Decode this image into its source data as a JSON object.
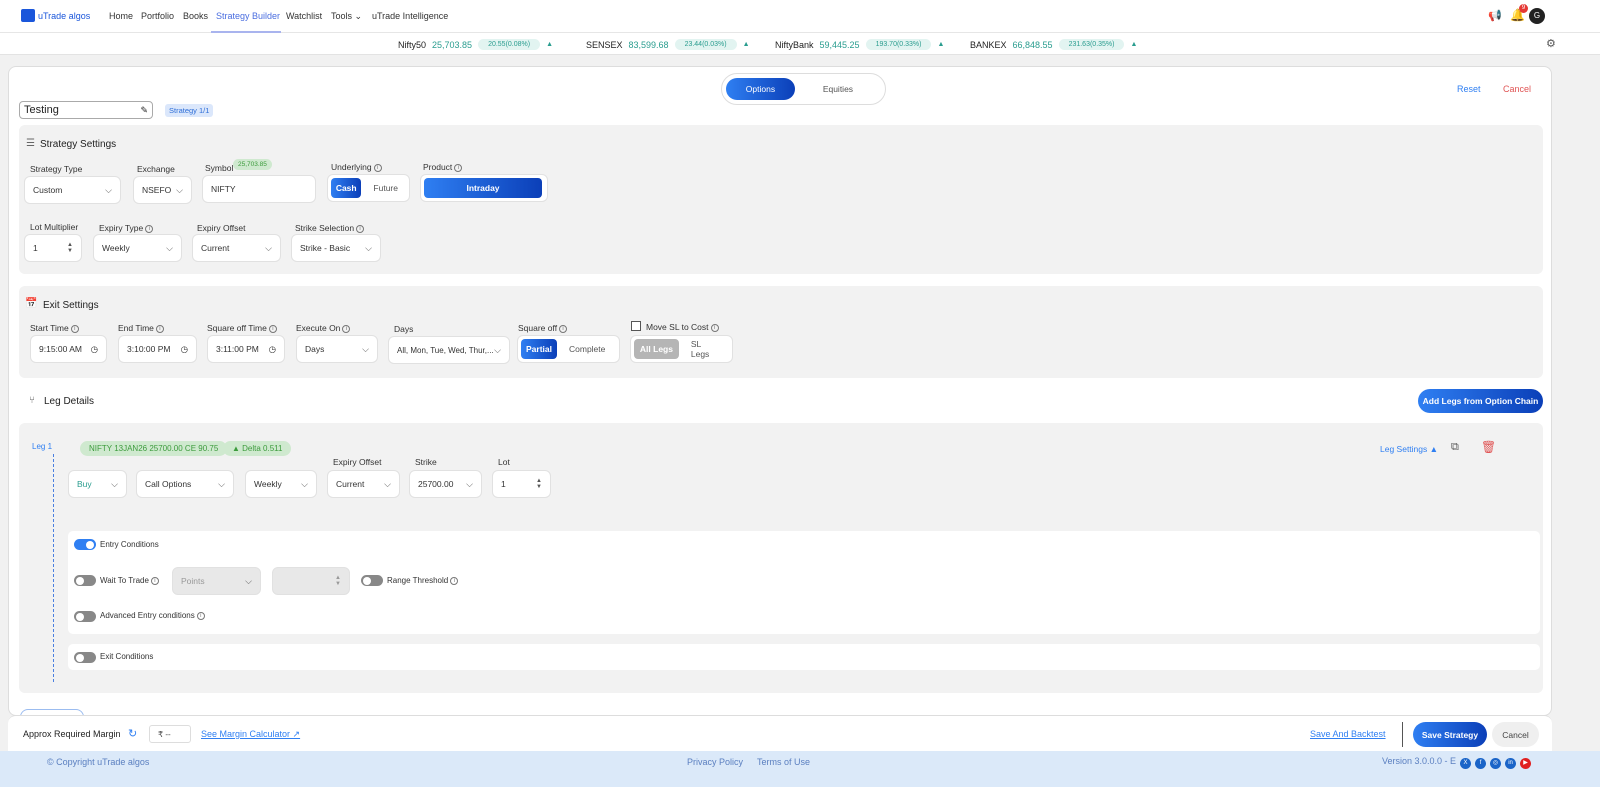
{
  "brand": {
    "name": "uTrade algos"
  },
  "nav": {
    "items": [
      "Home",
      "Portfolio",
      "Books",
      "Strategy Builder",
      "Watchlist",
      "Tools",
      "uTrade Intelligence"
    ],
    "active": "Strategy Builder",
    "notification_count": "9",
    "avatar": "G"
  },
  "ticker": [
    {
      "name": "Nifty50",
      "value": "25,703.85",
      "change": "20.55(0.08%)"
    },
    {
      "name": "SENSEX",
      "value": "83,599.68",
      "change": "23.44(0.03%)"
    },
    {
      "name": "NiftyBank",
      "value": "59,445.25",
      "change": "193.70(0.33%)"
    },
    {
      "name": "BANKEX",
      "value": "66,848.55",
      "change": "231.63(0.35%)"
    }
  ],
  "mode_tabs": {
    "options": "Options",
    "equities": "Equities",
    "active": "Options"
  },
  "header": {
    "strategy_name": "Testing",
    "strategy_badge": "Strategy 1/1",
    "reset": "Reset",
    "cancel": "Cancel"
  },
  "strategy_settings": {
    "title": "Strategy Settings",
    "strategy_type": {
      "label": "Strategy Type",
      "value": "Custom"
    },
    "exchange": {
      "label": "Exchange",
      "value": "NSEFO"
    },
    "symbol": {
      "label": "Symbol",
      "price": "25,703.85",
      "value": "NIFTY"
    },
    "underlying": {
      "label": "Underlying",
      "options": [
        "Cash",
        "Future"
      ],
      "selected": "Cash"
    },
    "product": {
      "label": "Product",
      "value": "Intraday"
    },
    "lot_multiplier": {
      "label": "Lot Multiplier",
      "value": "1"
    },
    "expiry_type": {
      "label": "Expiry Type",
      "value": "Weekly"
    },
    "expiry_offset": {
      "label": "Expiry Offset",
      "value": "Current"
    },
    "strike_selection": {
      "label": "Strike Selection",
      "value": "Strike - Basic"
    }
  },
  "exit_settings": {
    "title": "Exit Settings",
    "start_time": {
      "label": "Start Time",
      "value": "9:15:00 AM"
    },
    "end_time": {
      "label": "End Time",
      "value": "3:10:00 PM"
    },
    "square_off_time": {
      "label": "Square off Time",
      "value": "3:11:00 PM"
    },
    "execute_on": {
      "label": "Execute On",
      "value": "Days"
    },
    "days": {
      "label": "Days",
      "value": "All, Mon, Tue, Wed, Thur,..."
    },
    "square_off": {
      "label": "Square off",
      "options": [
        "Partial",
        "Complete"
      ],
      "selected": "Partial"
    },
    "move_sl": {
      "label": "Move SL to Cost",
      "checked": false,
      "options": [
        "All Legs",
        "SL Legs"
      ]
    }
  },
  "leg_details": {
    "title": "Leg Details",
    "add_button": "Add Legs from Option Chain",
    "legs": [
      {
        "label": "Leg 1",
        "contract": "NIFTY 13JAN26 25700.00 CE 90.75",
        "delta": "Delta 0.511",
        "settings": "Leg Settings",
        "side": "Buy",
        "option_type": "Call Options",
        "expiry": "Weekly",
        "expiry_offset_label": "Expiry Offset",
        "expiry_offset": "Current",
        "strike_label": "Strike",
        "strike": "25700.00",
        "lot_label": "Lot",
        "lot": "1",
        "entry_conditions": {
          "label": "Entry Conditions",
          "on": true
        },
        "wait_to_trade": {
          "label": "Wait To Trade",
          "on": false,
          "unit": "Points"
        },
        "range_threshold": {
          "label": "Range Threshold",
          "on": false
        },
        "advanced_entry": {
          "label": "Advanced Entry conditions",
          "on": false
        },
        "exit_conditions": {
          "label": "Exit Conditions",
          "on": false
        }
      }
    ]
  },
  "bottom_bar": {
    "margin_label": "Approx Required Margin",
    "margin_value": "₹ --",
    "margin_calc": "See Margin Calculator ↗",
    "save_backtest": "Save And Backtest",
    "save": "Save Strategy",
    "cancel": "Cancel"
  },
  "footer": {
    "copyright": "© Copyright uTrade algos",
    "privacy": "Privacy Policy",
    "terms": "Terms of Use",
    "version": "Version 3.0.0.0 - E"
  },
  "colors": {
    "accent": "#2f7ff2",
    "positive": "#2a9d8f",
    "danger": "#e05555"
  }
}
